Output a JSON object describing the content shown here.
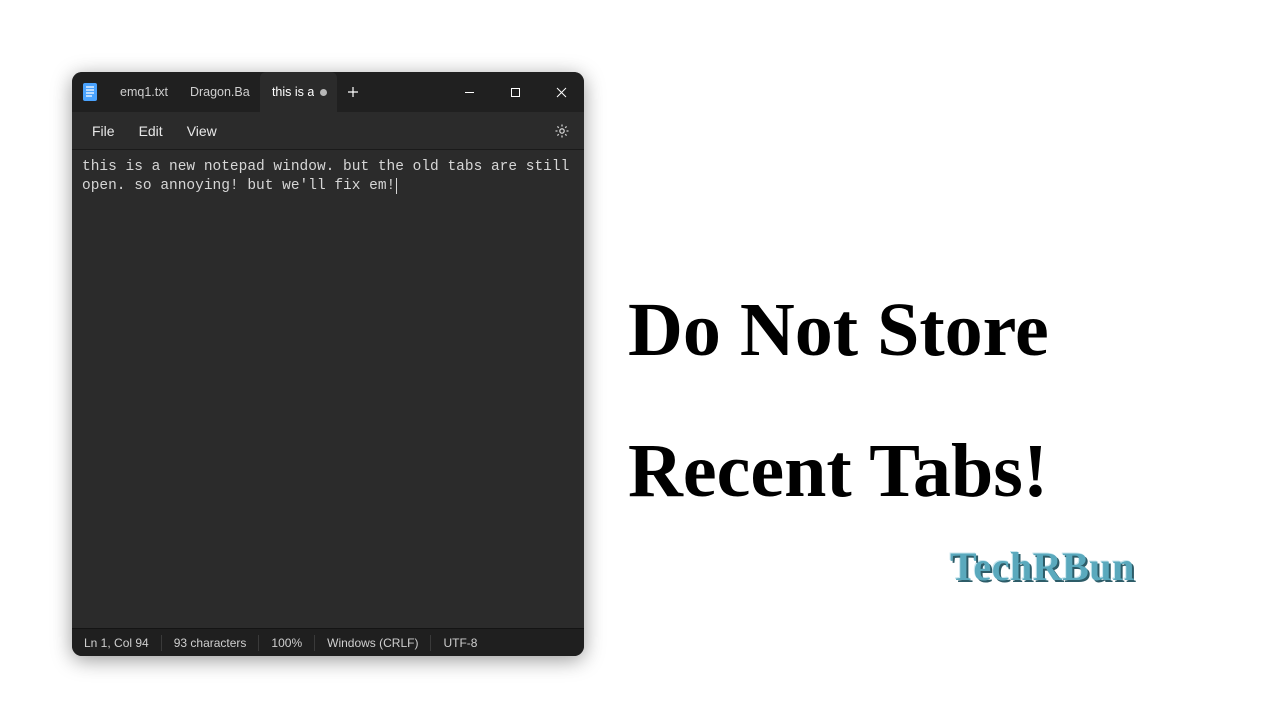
{
  "window": {
    "tabs": [
      {
        "label": "emq1.txt",
        "active": false,
        "modified": false
      },
      {
        "label": "Dragon.Ball.S",
        "active": false,
        "modified": false
      },
      {
        "label": "this is a",
        "active": true,
        "modified": true
      }
    ]
  },
  "menu": {
    "file": "File",
    "edit": "Edit",
    "view": "View"
  },
  "editor": {
    "content": "this is a new notepad window. but the old tabs are still open. so annoying! but we'll fix em!"
  },
  "status": {
    "position": "Ln 1, Col 94",
    "chars": "93 characters",
    "zoom": "100%",
    "line_ending": "Windows (CRLF)",
    "encoding": "UTF-8"
  },
  "headline": {
    "line1": "Do Not Store",
    "line2": "Recent Tabs!"
  },
  "brand": "TechRBun"
}
